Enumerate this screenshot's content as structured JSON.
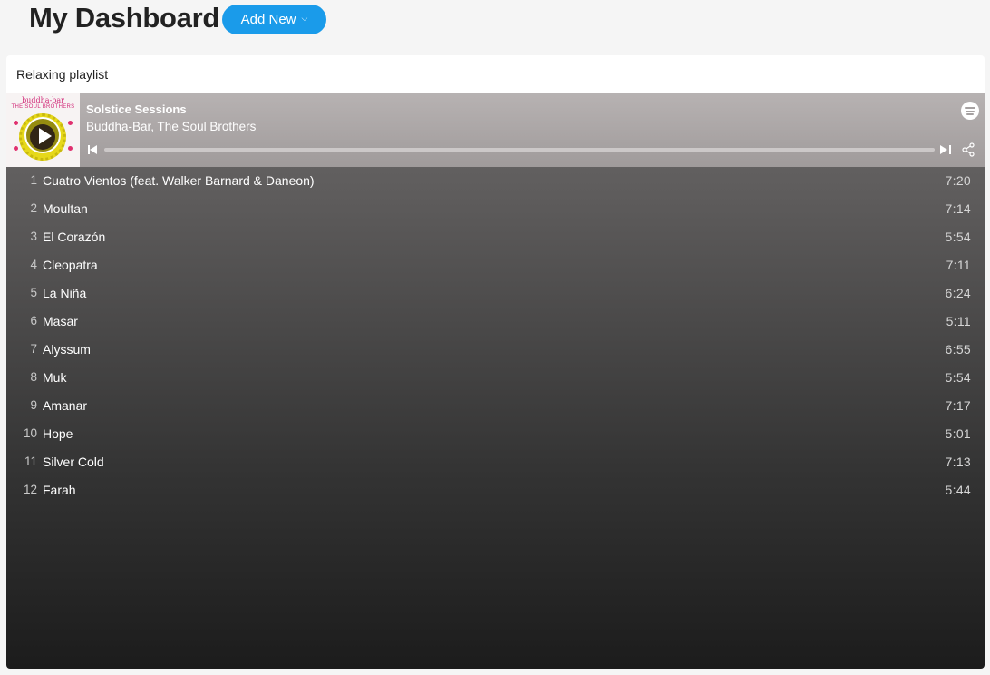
{
  "header": {
    "title": "My Dashboard",
    "add_new_label": "Add New",
    "add_new_icon": "chevron-down-icon"
  },
  "widget": {
    "title": "Relaxing playlist"
  },
  "player": {
    "cover_brand": "buddha-bar",
    "cover_subtitle": "THE SOUL BROTHERS",
    "track_title": "Solstice Sessions",
    "artists": "Buddha-Bar, The Soul Brothers",
    "progress_percent": 0,
    "icons": [
      "spotify-icon",
      "play-icon",
      "previous-icon",
      "next-icon",
      "share-icon"
    ]
  },
  "tracks": [
    {
      "num": "1",
      "name": "Cuatro Vientos (feat. Walker Barnard & Daneon)",
      "duration": "7:20"
    },
    {
      "num": "2",
      "name": "Moultan",
      "duration": "7:14"
    },
    {
      "num": "3",
      "name": "El Corazón",
      "duration": "5:54"
    },
    {
      "num": "4",
      "name": "Cleopatra",
      "duration": "7:11"
    },
    {
      "num": "5",
      "name": "La Niña",
      "duration": "6:24"
    },
    {
      "num": "6",
      "name": "Masar",
      "duration": "5:11"
    },
    {
      "num": "7",
      "name": "Alyssum",
      "duration": "6:55"
    },
    {
      "num": "8",
      "name": "Muk",
      "duration": "5:54"
    },
    {
      "num": "9",
      "name": "Amanar",
      "duration": "7:17"
    },
    {
      "num": "10",
      "name": "Hope",
      "duration": "5:01"
    },
    {
      "num": "11",
      "name": "Silver Cold",
      "duration": "7:13"
    },
    {
      "num": "12",
      "name": "Farah",
      "duration": "5:44"
    }
  ],
  "colors": {
    "accent": "#1a9bea",
    "brand_pink": "#d22b79"
  }
}
